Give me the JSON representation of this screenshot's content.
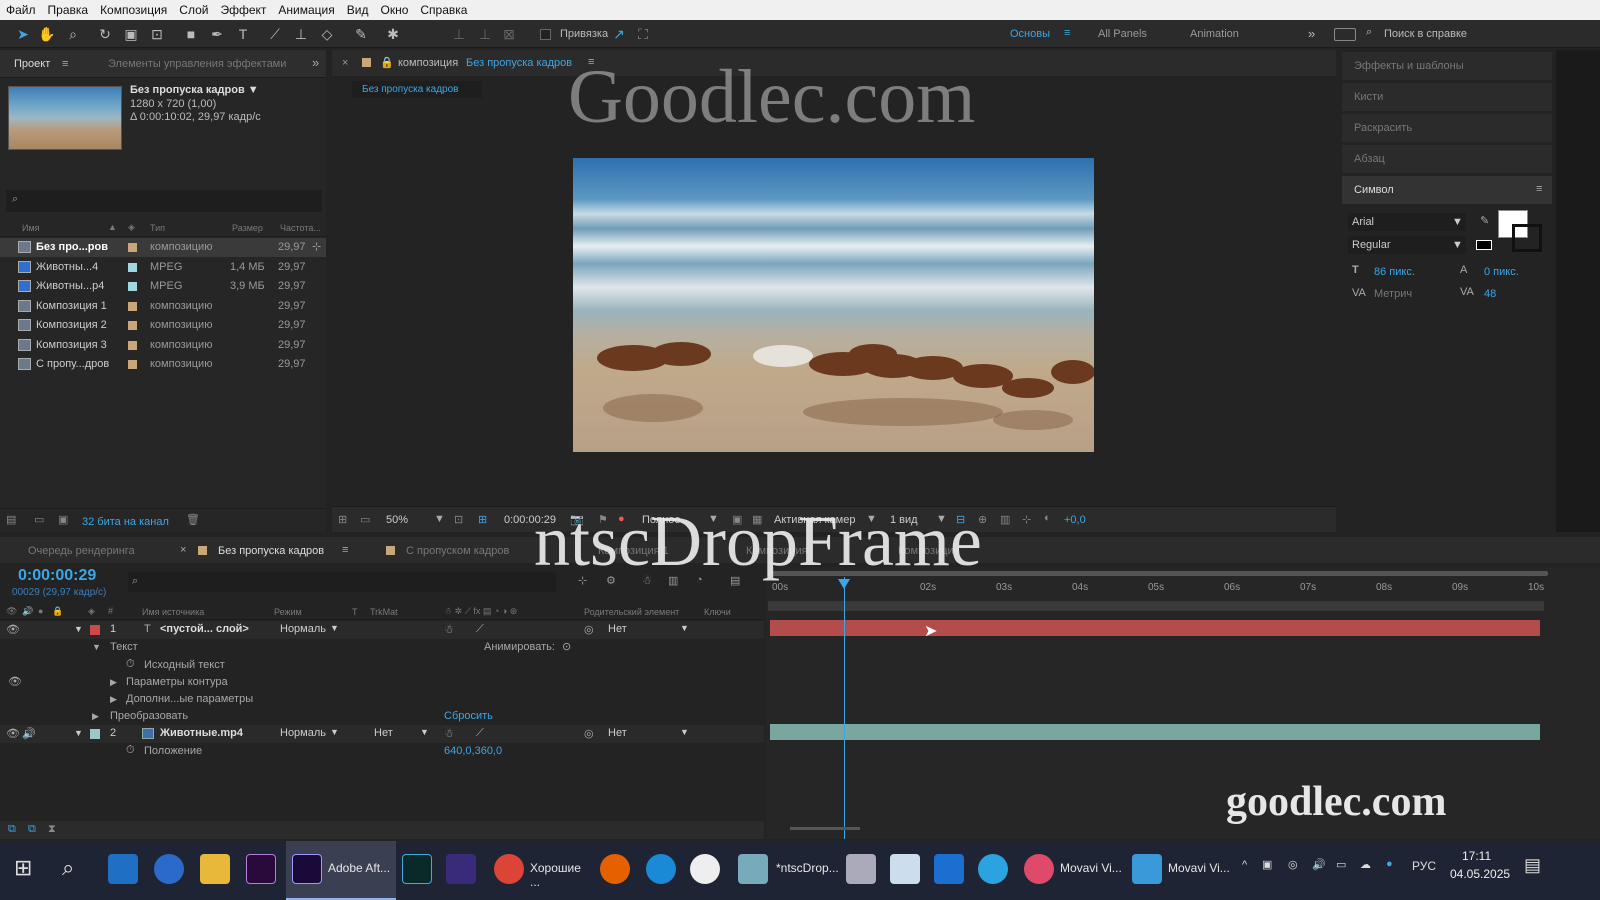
{
  "menu": [
    "Файл",
    "Правка",
    "Композиция",
    "Слой",
    "Эффект",
    "Анимация",
    "Вид",
    "Окно",
    "Справка"
  ],
  "toolbar": {
    "snap_label": "Привязка",
    "workspaces": [
      "Основы",
      "All Panels",
      "Animation"
    ],
    "search_placeholder": "Поиск в справке"
  },
  "project": {
    "tabs": [
      "Проект",
      "Элементы управления эффектами"
    ],
    "comp_name": "Без пропуска кадров ▼",
    "comp_info1": "1280 x 720 (1,00)",
    "comp_info2": "Δ 0:00:10:02, 29,97 кадр/с",
    "columns": [
      "Имя",
      "Тип",
      "Размер",
      "Частота..."
    ],
    "items": [
      {
        "name": "Без про...ров",
        "type": "композицию",
        "size": "",
        "fps": "29,97"
      },
      {
        "name": "Животны...4",
        "type": "MPEG",
        "size": "1,4 МБ",
        "fps": "29,97"
      },
      {
        "name": "Животны...p4",
        "type": "MPEG",
        "size": "3,9 МБ",
        "fps": "29,97"
      },
      {
        "name": "Композиция 1",
        "type": "композицию",
        "size": "",
        "fps": "29,97"
      },
      {
        "name": "Композиция 2",
        "type": "композицию",
        "size": "",
        "fps": "29,97"
      },
      {
        "name": "Композиция 3",
        "type": "композицию",
        "size": "",
        "fps": "29,97"
      },
      {
        "name": "С пропу...дров",
        "type": "композицию",
        "size": "",
        "fps": "29,97"
      }
    ],
    "bit_depth": "32 бита на канал"
  },
  "viewer": {
    "tab_prefix": "композиция",
    "tab_name": "Без пропуска кадров",
    "breadcrumb": "Без пропуска кадров",
    "zoom": "50%",
    "timecode": "0:00:00:29",
    "resolution": "Полное",
    "camera": "Активная камер",
    "view": "1 вид",
    "exposure": "+0,0"
  },
  "right_panel": {
    "sections": [
      "Эффекты и шаблоны",
      "Кисти",
      "Раскрасить",
      "Абзац"
    ],
    "character_title": "Символ",
    "font": "Arial",
    "style": "Regular",
    "size": "86 пикс.",
    "leading": "0 пикс.",
    "kerning": "Метрич",
    "tracking": "48"
  },
  "timeline": {
    "tabs": [
      "Очередь рендеринга",
      "Без пропуска кадров",
      "С пропуском кадров",
      "Композиция 1",
      "Композиция"
    ],
    "timecode": "0:00:00:29",
    "fps_info": "00029 (29,97 кадр/с)",
    "columns": [
      "Имя источника",
      "Режим",
      "T",
      "TrkMat",
      "Родительский элемент",
      "Ключи"
    ],
    "ruler": [
      "00s",
      "02s",
      "03s",
      "04s",
      "05s",
      "06s",
      "07s",
      "08s",
      "09s",
      "10s"
    ],
    "layers": [
      {
        "num": "1",
        "name": "<пустой... слой>",
        "mode": "Нормаль",
        "trk": "",
        "parent": "Нет"
      },
      {
        "num": "2",
        "name": "Животные.mp4",
        "mode": "Нормаль",
        "trk": "Нет",
        "parent": "Нет"
      }
    ],
    "props": {
      "text": "Текст",
      "animate": "Анимировать:",
      "source_text": "Исходный текст",
      "path": "Параметры контура",
      "more": "Дополни...ые параметры",
      "transform": "Преобразовать",
      "reset": "Сбросить",
      "position": "Положение",
      "position_val": "640,0,360,0"
    }
  },
  "watermarks": {
    "top": "Goodlec.com",
    "middle": "ntscDropFrame",
    "bottom": "goodlec.com"
  },
  "taskbar": {
    "items": [
      "Adobe Aft...",
      "Хорошие ...",
      "*ntscDrop...",
      "Movavi Vi...",
      "Movavi Vi..."
    ],
    "lang": "РУС",
    "time": "17:11",
    "date": "04.05.2025"
  }
}
